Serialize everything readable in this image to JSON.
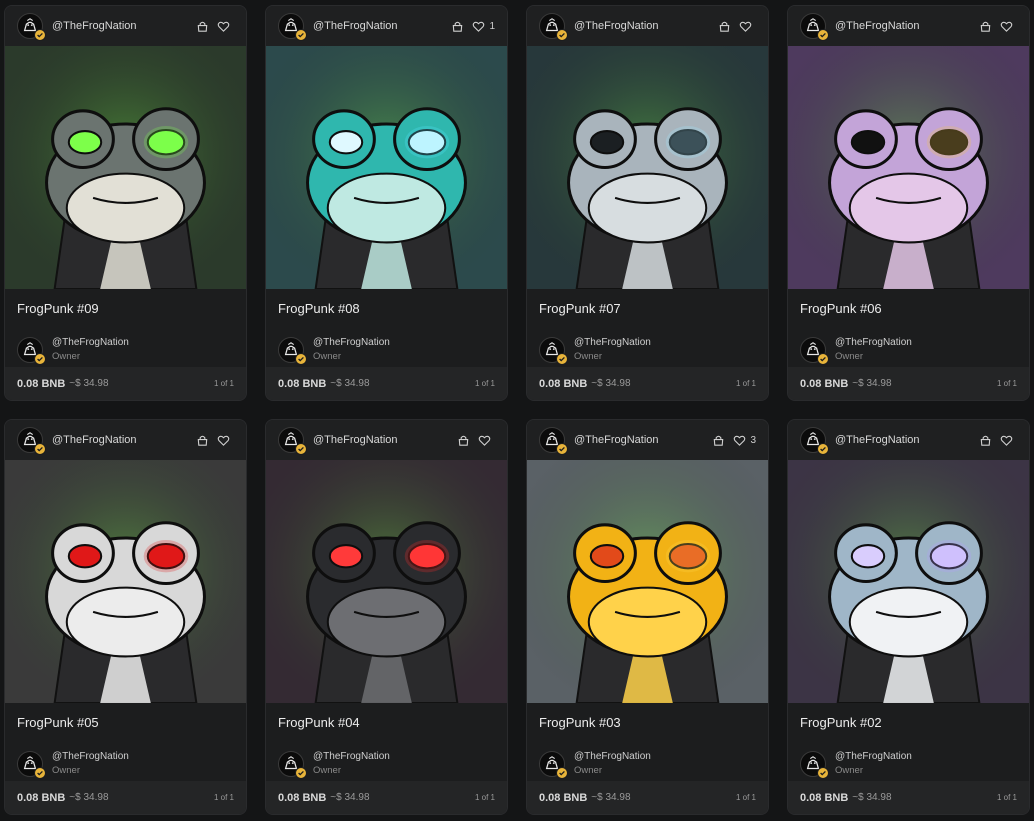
{
  "cards": [
    {
      "creator": "@TheFrogNation",
      "likes": "",
      "title": "FrogPunk #09",
      "owner": "@TheFrogNation",
      "owner_role": "Owner",
      "price": "0.08 BNB",
      "usd": "~$ 34.98",
      "edition": "1 of 1",
      "bg": "#2b3a2b",
      "skin": "#6b7470",
      "belly": "#e2e0d6",
      "glow": "#7dff4a",
      "eye": "#7dff4a"
    },
    {
      "creator": "@TheFrogNation",
      "likes": "1",
      "title": "FrogPunk #08",
      "owner": "@TheFrogNation",
      "owner_role": "Owner",
      "price": "0.08 BNB",
      "usd": "~$ 34.98",
      "edition": "1 of 1",
      "bg": "#2c4a4c",
      "skin": "#2fb7ae",
      "belly": "#bfe9e2",
      "glow": "#56e7ff",
      "eye": "#dff9ff"
    },
    {
      "creator": "@TheFrogNation",
      "likes": "",
      "title": "FrogPunk #07",
      "owner": "@TheFrogNation",
      "owner_role": "Owner",
      "price": "0.08 BNB",
      "usd": "~$ 34.98",
      "edition": "1 of 1",
      "bg": "#27383b",
      "skin": "#a9b4bc",
      "belly": "#d7dde0",
      "glow": "#9fe6ff",
      "eye": "#1b1f22"
    },
    {
      "creator": "@TheFrogNation",
      "likes": "",
      "title": "FrogPunk #06",
      "owner": "@TheFrogNation",
      "owner_role": "Owner",
      "price": "0.08 BNB",
      "usd": "~$ 34.98",
      "edition": "1 of 1",
      "bg": "#4e3a5e",
      "skin": "#c3a4d8",
      "belly": "#e4c7e8",
      "glow": "#f5c542",
      "eye": "#111111"
    },
    {
      "creator": "@TheFrogNation",
      "likes": "",
      "title": "FrogPunk #05",
      "owner": "@TheFrogNation",
      "owner_role": "Owner",
      "price": "0.08 BNB",
      "usd": "~$ 34.98",
      "edition": "1 of 1",
      "bg": "#3a3a3a",
      "skin": "#d8d8d8",
      "belly": "#ececec",
      "glow": "#e01818",
      "eye": "#e01818"
    },
    {
      "creator": "@TheFrogNation",
      "likes": "",
      "title": "FrogPunk #04",
      "owner": "@TheFrogNation",
      "owner_role": "Owner",
      "price": "0.08 BNB",
      "usd": "~$ 34.98",
      "edition": "1 of 1",
      "bg": "#342a33",
      "skin": "#2a2b2e",
      "belly": "#6d6e72",
      "glow": "#ff2a2a",
      "eye": "#ff3a3a"
    },
    {
      "creator": "@TheFrogNation",
      "likes": "3",
      "title": "FrogPunk #03",
      "owner": "@TheFrogNation",
      "owner_role": "Owner",
      "price": "0.08 BNB",
      "usd": "~$ 34.98",
      "edition": "1 of 1",
      "bg": "#5a6166",
      "skin": "#f2b215",
      "belly": "#ffd24a",
      "glow": "#ffd84a",
      "eye": "#e24a1a"
    },
    {
      "creator": "@TheFrogNation",
      "likes": "",
      "title": "FrogPunk #02",
      "owner": "@TheFrogNation",
      "owner_role": "Owner",
      "price": "0.08 BNB",
      "usd": "~$ 34.98",
      "edition": "1 of 1",
      "bg": "#3c3445",
      "skin": "#9fb6c8",
      "belly": "#f0f2f4",
      "glow": "#b49bff",
      "eye": "#d9cdfd"
    }
  ]
}
